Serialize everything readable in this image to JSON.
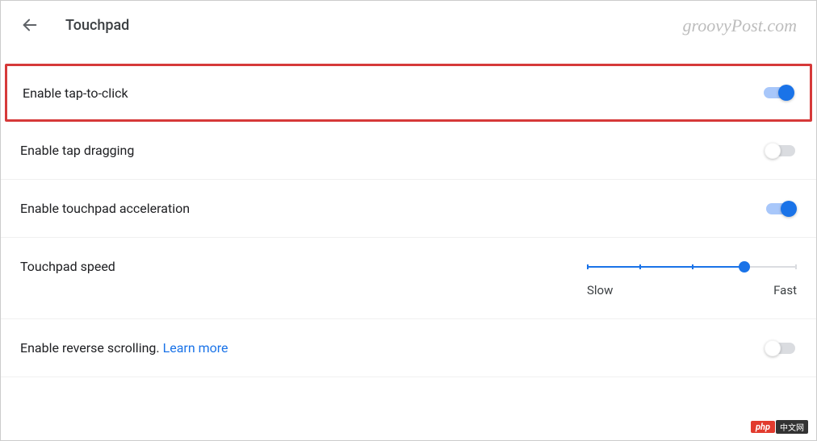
{
  "header": {
    "title": "Touchpad",
    "watermark": "groovyPost.com"
  },
  "settings": {
    "tap_to_click": {
      "label": "Enable tap-to-click",
      "value": true
    },
    "tap_dragging": {
      "label": "Enable tap dragging",
      "value": false
    },
    "acceleration": {
      "label": "Enable touchpad acceleration",
      "value": true
    },
    "speed": {
      "label": "Touchpad speed",
      "slow_label": "Slow",
      "fast_label": "Fast",
      "value": 4,
      "max": 5
    },
    "reverse_scroll": {
      "label": "Enable reverse scrolling. ",
      "learn_more": "Learn more",
      "value": false
    }
  },
  "badge": {
    "php": "php",
    "cn": "中文网"
  }
}
